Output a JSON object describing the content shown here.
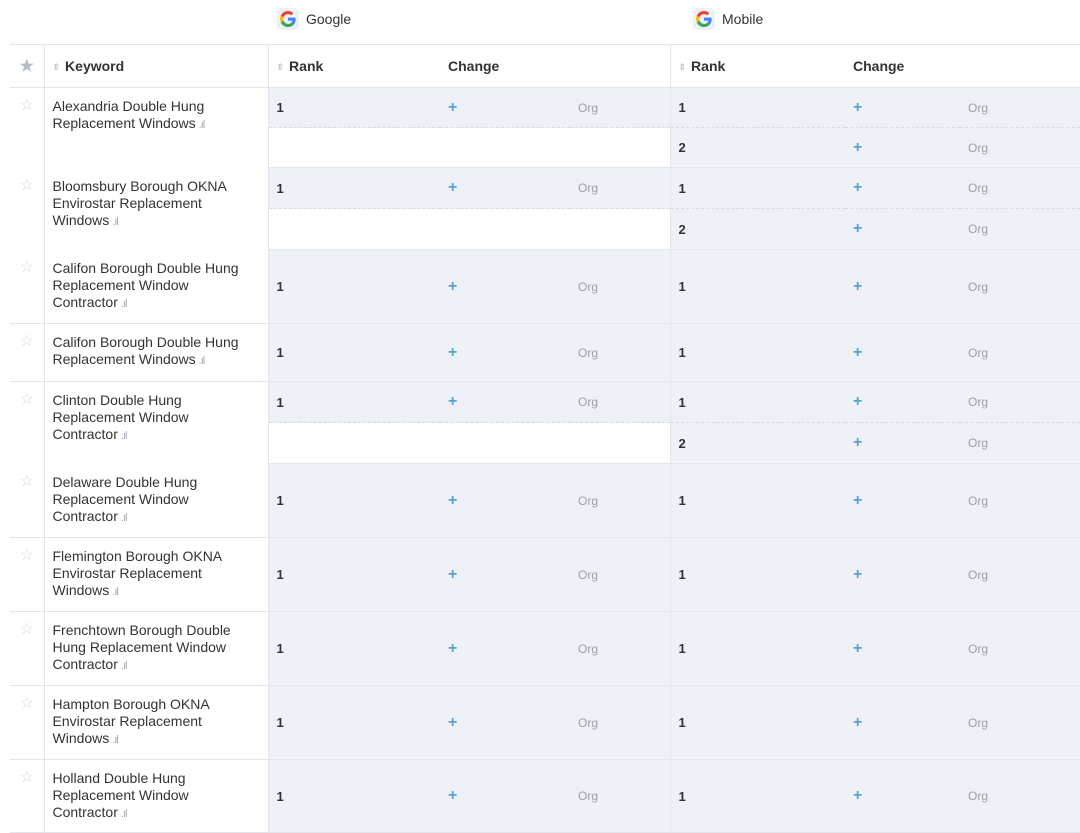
{
  "engines": [
    {
      "label": "Google",
      "icon": "google-icon"
    },
    {
      "label": "Mobile",
      "icon": "google-icon"
    }
  ],
  "columns": {
    "keyword": "Keyword",
    "rank": "Rank",
    "change": "Change"
  },
  "colors": {
    "accent_plus": "#5aa3c9",
    "row_bg": "#eef1f7",
    "border": "#e3e6ea"
  },
  "rows": [
    {
      "keyword": "Alexandria Double Hung Replacement Windows",
      "google": [
        {
          "rank": "1",
          "change": "+",
          "type": "Org"
        }
      ],
      "mobile": [
        {
          "rank": "1",
          "change": "+",
          "type": "Org"
        },
        {
          "rank": "2",
          "change": "+",
          "type": "Org"
        }
      ]
    },
    {
      "keyword": "Bloomsbury Borough OKNA Envirostar Replacement Windows",
      "google": [
        {
          "rank": "1",
          "change": "+",
          "type": "Org"
        }
      ],
      "mobile": [
        {
          "rank": "1",
          "change": "+",
          "type": "Org"
        },
        {
          "rank": "2",
          "change": "+",
          "type": "Org"
        }
      ]
    },
    {
      "keyword": "Califon Borough Double Hung Replacement Window Contractor",
      "google": [
        {
          "rank": "1",
          "change": "+",
          "type": "Org"
        }
      ],
      "mobile": [
        {
          "rank": "1",
          "change": "+",
          "type": "Org"
        }
      ]
    },
    {
      "keyword": "Califon Borough Double Hung Replacement Windows",
      "google": [
        {
          "rank": "1",
          "change": "+",
          "type": "Org"
        }
      ],
      "mobile": [
        {
          "rank": "1",
          "change": "+",
          "type": "Org"
        }
      ]
    },
    {
      "keyword": "Clinton Double Hung Replacement Window Contractor",
      "google": [
        {
          "rank": "1",
          "change": "+",
          "type": "Org"
        }
      ],
      "mobile": [
        {
          "rank": "1",
          "change": "+",
          "type": "Org"
        },
        {
          "rank": "2",
          "change": "+",
          "type": "Org"
        }
      ]
    },
    {
      "keyword": "Delaware Double Hung Replacement Window Contractor",
      "google": [
        {
          "rank": "1",
          "change": "+",
          "type": "Org"
        }
      ],
      "mobile": [
        {
          "rank": "1",
          "change": "+",
          "type": "Org"
        }
      ]
    },
    {
      "keyword": "Flemington Borough OKNA Envirostar Replacement Windows",
      "google": [
        {
          "rank": "1",
          "change": "+",
          "type": "Org"
        }
      ],
      "mobile": [
        {
          "rank": "1",
          "change": "+",
          "type": "Org"
        }
      ]
    },
    {
      "keyword": "Frenchtown Borough Double Hung Replacement Window Contractor",
      "google": [
        {
          "rank": "1",
          "change": "+",
          "type": "Org"
        }
      ],
      "mobile": [
        {
          "rank": "1",
          "change": "+",
          "type": "Org"
        }
      ]
    },
    {
      "keyword": "Hampton Borough OKNA Envirostar Replacement Windows",
      "google": [
        {
          "rank": "1",
          "change": "+",
          "type": "Org"
        }
      ],
      "mobile": [
        {
          "rank": "1",
          "change": "+",
          "type": "Org"
        }
      ]
    },
    {
      "keyword": "Holland Double Hung Replacement Window Contractor",
      "google": [
        {
          "rank": "1",
          "change": "+",
          "type": "Org"
        }
      ],
      "mobile": [
        {
          "rank": "1",
          "change": "+",
          "type": "Org"
        }
      ]
    }
  ]
}
